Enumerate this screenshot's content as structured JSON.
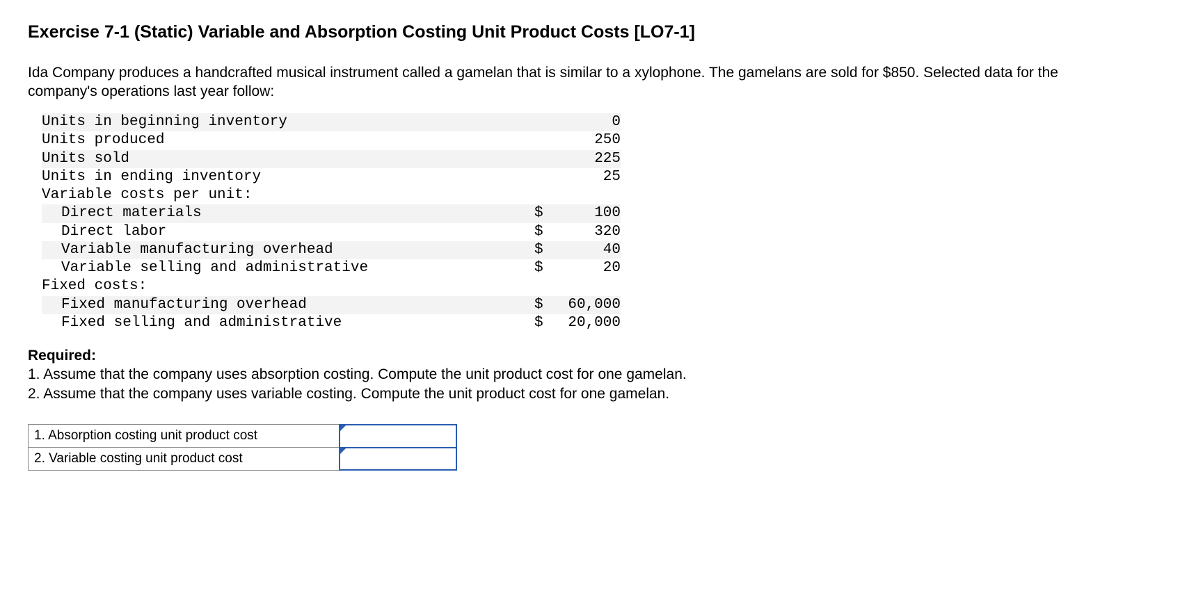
{
  "title": "Exercise 7-1 (Static) Variable and Absorption Costing Unit Product Costs [LO7-1]",
  "intro": "Ida Company produces a handcrafted musical instrument called a gamelan that is similar to a xylophone. The gamelans are sold for $850. Selected data for the company's operations last year follow:",
  "rows": {
    "r0": {
      "label": "Units in beginning inventory",
      "cur": "",
      "val": "0"
    },
    "r1": {
      "label": "Units produced",
      "cur": "",
      "val": "250"
    },
    "r2": {
      "label": "Units sold",
      "cur": "",
      "val": "225"
    },
    "r3": {
      "label": "Units in ending inventory",
      "cur": "",
      "val": "25"
    },
    "r4": {
      "label": "Variable costs per unit:",
      "cur": "",
      "val": ""
    },
    "r5": {
      "label": "Direct materials",
      "cur": "$",
      "val": "100"
    },
    "r6": {
      "label": "Direct labor",
      "cur": "$",
      "val": "320"
    },
    "r7": {
      "label": "Variable manufacturing overhead",
      "cur": "$",
      "val": "40"
    },
    "r8": {
      "label": "Variable selling and administrative",
      "cur": "$",
      "val": "20"
    },
    "r9": {
      "label": "Fixed costs:",
      "cur": "",
      "val": ""
    },
    "r10": {
      "label": "Fixed manufacturing overhead",
      "cur": "$",
      "val": "60,000"
    },
    "r11": {
      "label": "Fixed selling and administrative",
      "cur": "$",
      "val": "20,000"
    }
  },
  "required": {
    "heading": "Required:",
    "q1": "1. Assume that the company uses absorption costing. Compute the unit product cost for one gamelan.",
    "q2": "2. Assume that the company uses variable costing. Compute the unit product cost for one gamelan."
  },
  "answers": {
    "a1label": "1. Absorption costing unit product cost",
    "a2label": "2. Variable costing unit product cost",
    "a1value": "",
    "a2value": ""
  }
}
